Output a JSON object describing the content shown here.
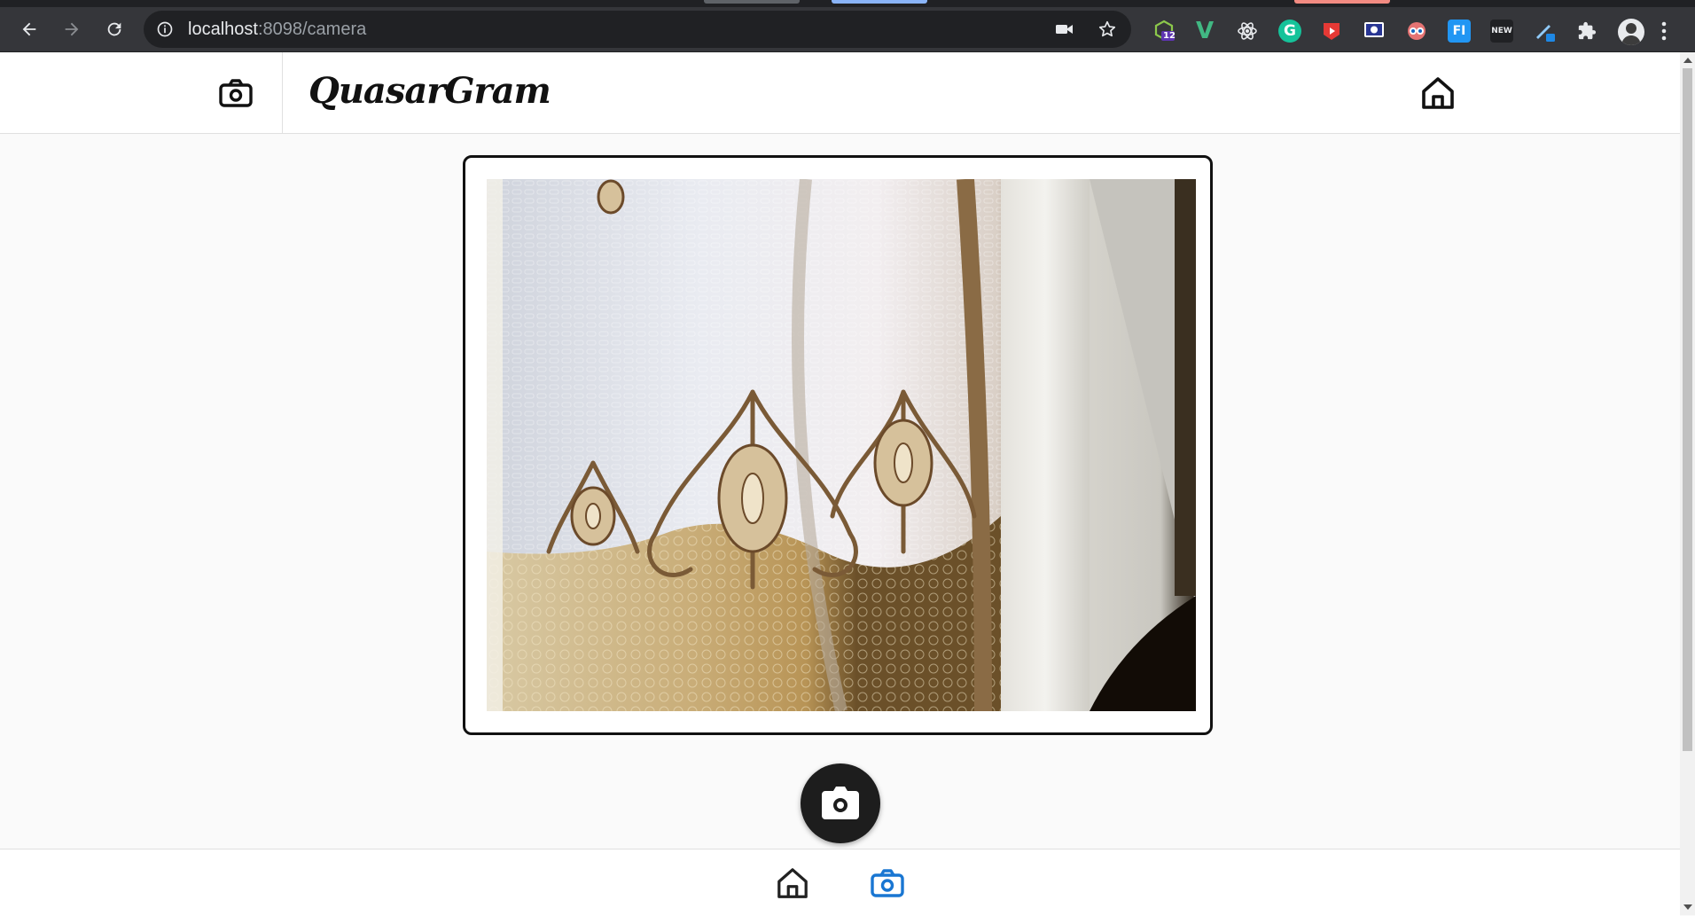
{
  "browser": {
    "url_host": "localhost",
    "url_path": ":8098/camera",
    "extensions": [
      {
        "name": "node-ext",
        "badge": "12",
        "color": "#8cc84b"
      },
      {
        "name": "vue-devtools",
        "glyph": "V",
        "color": "#41b883"
      },
      {
        "name": "react-devtools",
        "glyph": "⚛",
        "color": "#e8eaed"
      },
      {
        "name": "grammarly",
        "glyph": "G",
        "color": "#15c39a"
      },
      {
        "name": "video-ext",
        "glyph": "▶",
        "color": "#e53935"
      },
      {
        "name": "screencast-ext",
        "glyph": "▣",
        "color": "#3f51b5"
      },
      {
        "name": "eyes-ext",
        "glyph": "◉",
        "color": "#e57373"
      },
      {
        "name": "fi-ext",
        "glyph": "FI",
        "color": "#2196f3"
      },
      {
        "name": "new-ext",
        "glyph": "NEW",
        "color": "#1e88e5"
      },
      {
        "name": "pen-ext",
        "glyph": "✎",
        "color": "#90caf9"
      },
      {
        "name": "extensions-menu",
        "glyph": "✚",
        "color": "#e8eaed"
      }
    ]
  },
  "app": {
    "title": "QuasarGram"
  },
  "page": {
    "capture_button_icon": "camera-icon"
  },
  "colors": {
    "active_tab": "#1976d2",
    "inactive_tab": "#212121"
  }
}
